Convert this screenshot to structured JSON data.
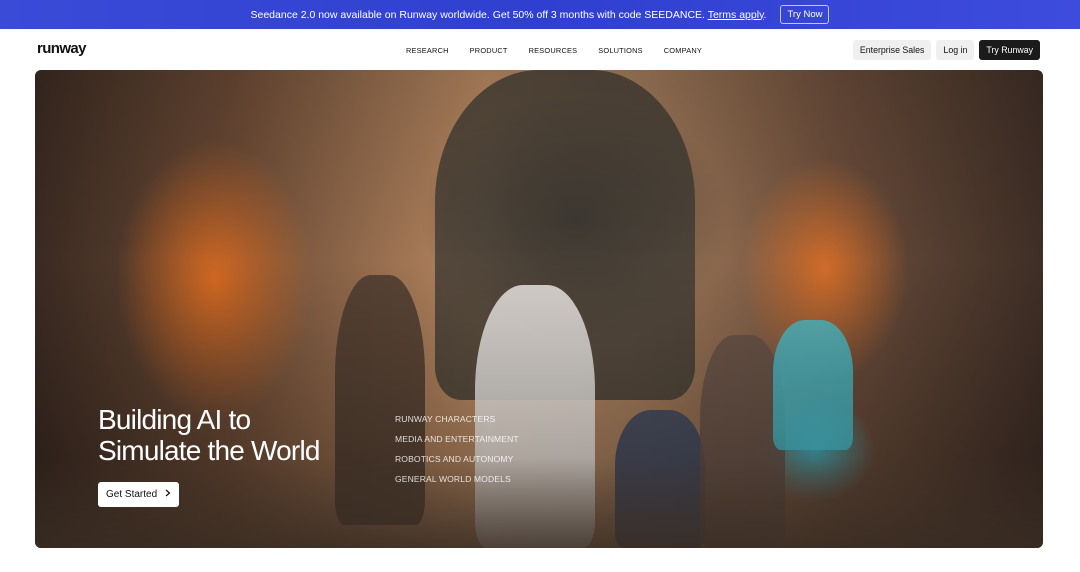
{
  "announcement": {
    "message": "Seedance 2.0 now available on Runway worldwide. Get 50% off 3 months with code SEEDANCE.",
    "terms_label": "Terms apply",
    "terms_suffix": ".",
    "cta_label": "Try Now",
    "background_color": "#3442d4"
  },
  "nav": {
    "logo": "runway",
    "menu": [
      "RESEARCH",
      "PRODUCT",
      "RESOURCES",
      "SOLUTIONS",
      "COMPANY"
    ],
    "enterprise_label": "Enterprise Sales",
    "login_label": "Log in",
    "try_label": "Try Runway"
  },
  "hero": {
    "headline_line1": "Building AI to",
    "headline_line2": "Simulate the World",
    "cta_label": "Get Started",
    "cta_icon": "chevron-right-icon",
    "links": [
      "RUNWAY CHARACTERS",
      "MEDIA AND ENTERTAINMENT",
      "ROBOTICS AND AUTONOMY",
      "GENERAL WORLD MODELS"
    ]
  }
}
